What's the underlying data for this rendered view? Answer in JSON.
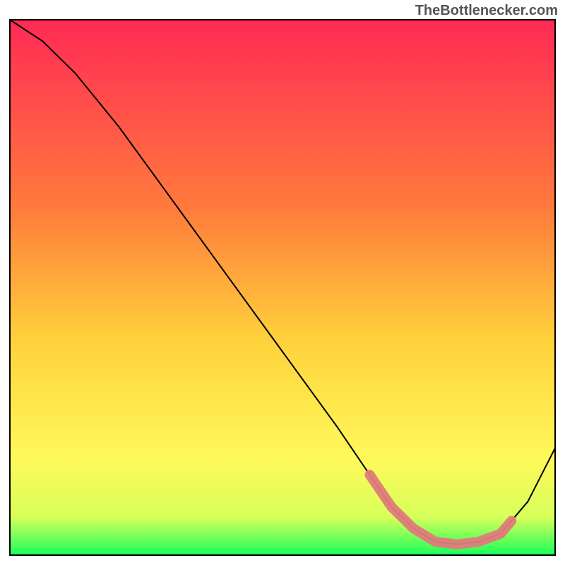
{
  "watermark": "TheBottlenecker.com",
  "chart_data": {
    "type": "line",
    "title": "",
    "xlabel": "",
    "ylabel": "",
    "xlim": [
      0,
      100
    ],
    "ylim": [
      0,
      100
    ],
    "series": [
      {
        "name": "curve",
        "x": [
          0,
          6,
          12,
          20,
          30,
          40,
          50,
          60,
          66,
          70,
          74,
          78,
          82,
          86,
          90,
          95,
          100
        ],
        "y": [
          100,
          96,
          90,
          80,
          66,
          52,
          38,
          24,
          15,
          9,
          5,
          2.5,
          2,
          2.5,
          4,
          10,
          20
        ]
      }
    ],
    "highlight_region": {
      "start_x": 66,
      "end_x": 92,
      "band_type": "near-bottom",
      "color": "#e07b7b"
    },
    "gradient_stops": [
      {
        "offset": 0.0,
        "color": "#ff2a55"
      },
      {
        "offset": 0.35,
        "color": "#ff7a3c"
      },
      {
        "offset": 0.6,
        "color": "#ffd23c"
      },
      {
        "offset": 0.82,
        "color": "#fff95a"
      },
      {
        "offset": 0.93,
        "color": "#d6ff5a"
      },
      {
        "offset": 1.0,
        "color": "#1aff5a"
      }
    ],
    "frame_color": "#000000"
  }
}
